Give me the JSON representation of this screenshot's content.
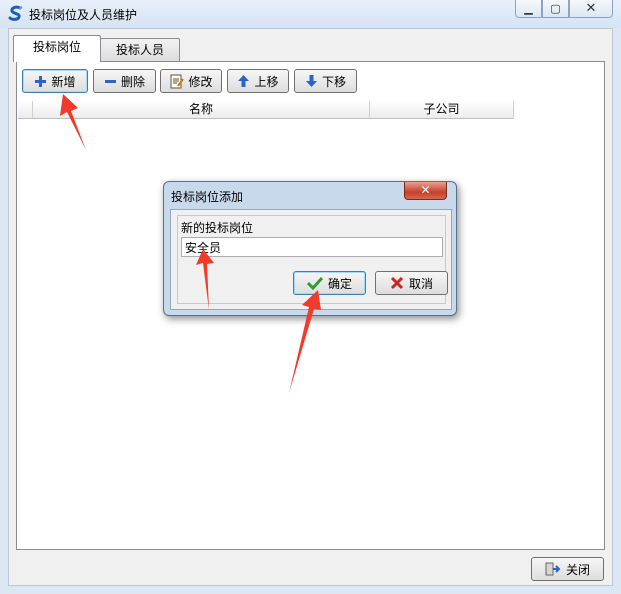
{
  "window": {
    "title": "投标岗位及人员维护",
    "controls": [
      "minimize-icon",
      "maximize-icon",
      "close-icon"
    ]
  },
  "tabs": [
    {
      "label": "投标岗位",
      "active": true
    },
    {
      "label": "投标人员",
      "active": false
    }
  ],
  "toolbar": {
    "add_label": "新增",
    "delete_label": "删除",
    "edit_label": "修改",
    "up_label": "上移",
    "down_label": "下移"
  },
  "grid": {
    "columns": [
      "名称",
      "子公司"
    ],
    "rows": []
  },
  "footer": {
    "close_label": "关闭"
  },
  "dialog": {
    "title": "投标岗位添加",
    "field_label": "新的投标岗位",
    "field_value": "安全员",
    "ok_label": "确定",
    "cancel_label": "取消"
  },
  "colors": {
    "annotation_arrow": "#f03a2a",
    "title_bar": "#dce7f3",
    "ok_check": "#2e9c2e",
    "cancel_x": "#c8281e",
    "toolbar_icon_blue": "#2b63c9"
  }
}
